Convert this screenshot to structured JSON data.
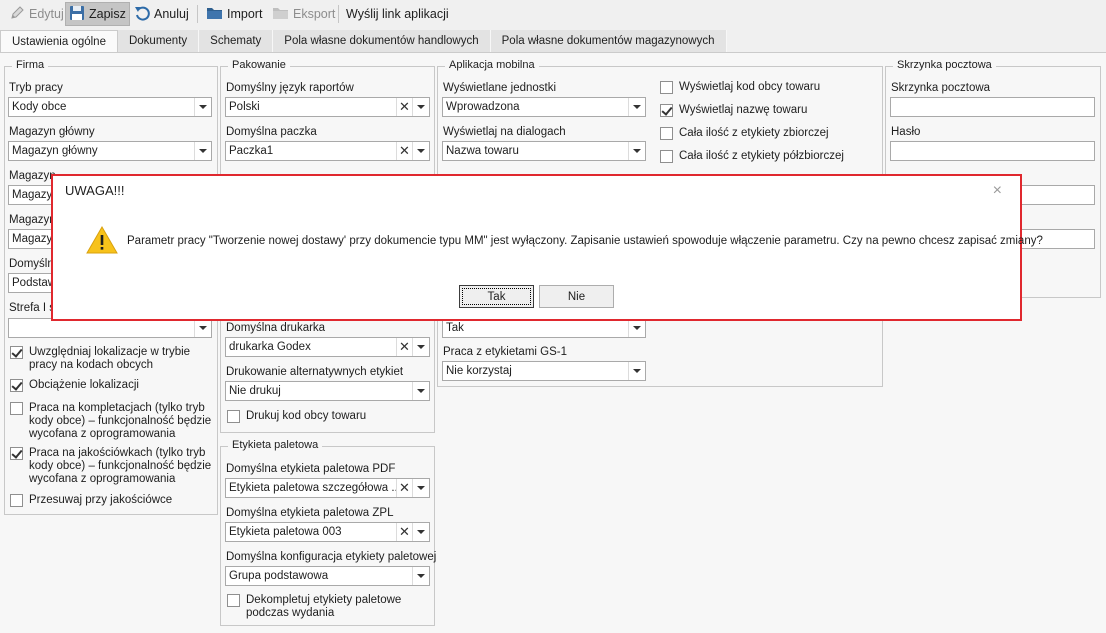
{
  "toolbar": {
    "edit_label": "Edytuj",
    "save_label": "Zapisz",
    "cancel_label": "Anuluj",
    "import_label": "Import",
    "export_label": "Eksport",
    "send_link_label": "Wyślij link aplikacji"
  },
  "tabs": [
    "Ustawienia ogólne",
    "Dokumenty",
    "Schematy",
    "Pola własne dokumentów handlowych",
    "Pola własne dokumentów magazynowych"
  ],
  "firma": {
    "title": "Firma",
    "tryb_label": "Tryb pracy",
    "tryb_value": "Kody obce",
    "magazyn_label": "Magazyn główny",
    "magazyn_value": "Magazyn główny",
    "magazyn2_label": "Magazyn",
    "magazyn2_value": "Magazyn",
    "magazyn3_label": "Magazyn",
    "magazyn3_value": "Magazyn",
    "domyslna_label": "Domyślna",
    "domyslna_value": "Podstaw",
    "strefa_label": "Strefa I s",
    "strefa_value": "",
    "checks": [
      {
        "label": "Uwzględniaj lokalizacje w trybie pracy na kodach obcych",
        "checked": true
      },
      {
        "label": "Obciążenie lokalizacji",
        "checked": true
      },
      {
        "label": "Praca na kompletacjach (tylko tryb kody obce) – funkcjonalność będzie wycofana z oprogramowania",
        "checked": false
      },
      {
        "label": "Praca na jakościówkach (tylko tryb kody obce) – funkcjonalność będzie wycofana z oprogramowania",
        "checked": true
      },
      {
        "label": "Przesuwaj przy jakościówce",
        "checked": false
      }
    ]
  },
  "pakowanie": {
    "title": "Pakowanie",
    "jezyk_label": "Domyślny język raportów",
    "jezyk_value": "Polski",
    "paczka_label": "Domyślna paczka",
    "paczka_value": "Paczka1",
    "drukarka_label": "Domyślna drukarka",
    "drukarka_value": "drukarka Godex",
    "alt_label": "Drukowanie alternatywnych etykiet",
    "alt_value": "Nie drukuj",
    "kod_obcy_label": "Drukuj kod obcy towaru"
  },
  "etykieta": {
    "title": "Etykieta paletowa",
    "pdf_label": "Domyślna etykieta paletowa PDF",
    "pdf_value": "Etykieta paletowa szczegółowa ...",
    "zpl_label": "Domyślna etykieta paletowa ZPL",
    "zpl_value": "Etykieta paletowa 003",
    "konf_label": "Domyślna konfiguracja etykiety paletowej",
    "konf_value": "Grupa podstawowa",
    "dekomp_label": "Dekompletuj etykiety paletowe podczas wydania"
  },
  "mobilna": {
    "title": "Aplikacja mobilna",
    "jednostki_label": "Wyświetlane jednostki",
    "jednostki_value": "Wprowadzona",
    "dialog_label": "Wyświetlaj na dialogach",
    "dialog_value": "Nazwa towaru",
    "tak_value": "Tak",
    "gs1_label": "Praca z etykietami GS-1",
    "gs1_value": "Nie korzystaj",
    "checks": [
      {
        "label": "Wyświetlaj kod obcy towaru",
        "checked": false
      },
      {
        "label": "Wyświetlaj nazwę towaru",
        "checked": true
      },
      {
        "label": "Cała ilość z etykiety zbiorczej",
        "checked": false
      },
      {
        "label": "Cała ilość z etykiety półzbiorczej",
        "checked": false
      }
    ]
  },
  "skrzynka": {
    "title": "Skrzynka pocztowa",
    "skrzynka_label": "Skrzynka pocztowa",
    "haslo_label": "Hasło"
  },
  "dialog": {
    "title": "UWAGA!!!",
    "message": "Parametr pracy \"Tworzenie nowej dostawy' przy dokumencie typu MM\" jest wyłączony. Zapisanie ustawień spowoduje włączenie parametru. Czy na pewno chcesz zapisać zmiany?",
    "yes_label": "Tak",
    "no_label": "Nie",
    "close_glyph": "×"
  }
}
